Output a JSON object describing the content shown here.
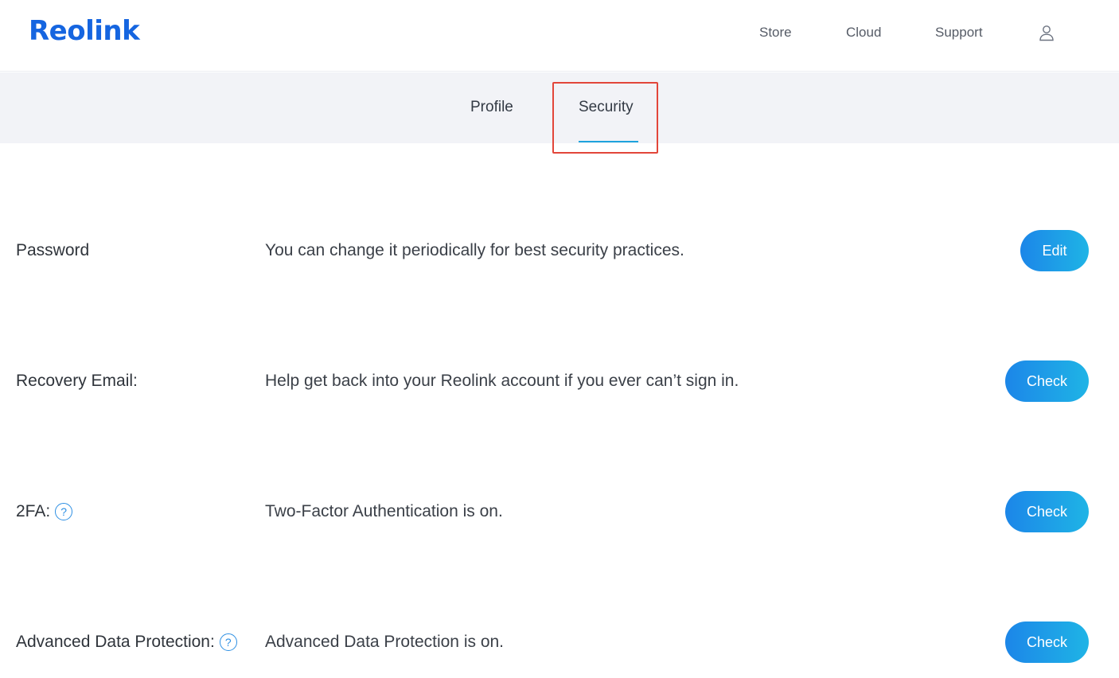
{
  "header": {
    "logo": "Reolink",
    "nav": [
      "Store",
      "Cloud",
      "Support"
    ],
    "user_icon": "user-icon"
  },
  "tabs": {
    "items": [
      "Profile",
      "Security"
    ],
    "active": "Security"
  },
  "colors": {
    "brand": "#1565e0",
    "accent": "#1ea3dd",
    "highlight": "#e2463a",
    "button_start": "#1c86e8",
    "button_end": "#1fb4e6"
  },
  "rows": [
    {
      "label": "Password",
      "description": "You can change it periodically for best security practices.",
      "button": "Edit"
    },
    {
      "label": "Recovery Email:",
      "description": "Help get back into your Reolink account if you ever can’t sign in.",
      "button": "Check"
    },
    {
      "label": "2FA:",
      "description": "Two-Factor Authentication is on.",
      "button": "Check",
      "help_icon": "?"
    },
    {
      "label": "Advanced Data Protection:",
      "description": "Advanced Data Protection is on.",
      "button": "Check",
      "help_icon": "?"
    }
  ]
}
